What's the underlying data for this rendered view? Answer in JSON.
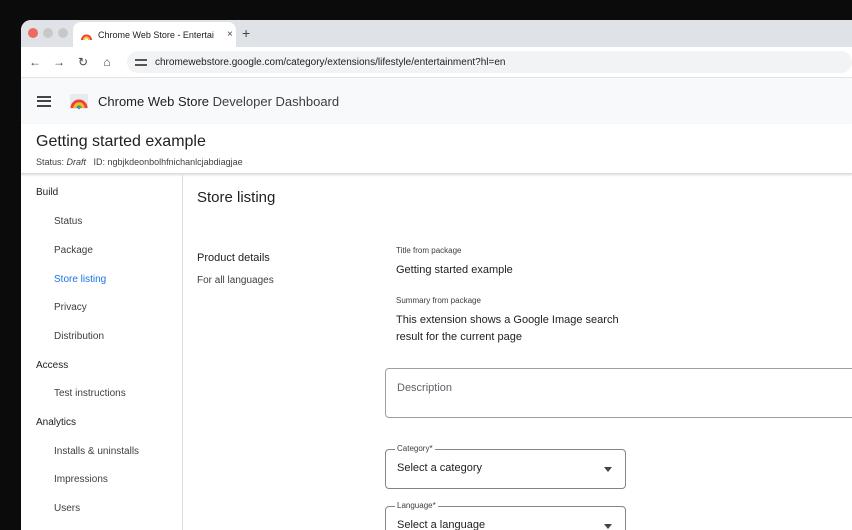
{
  "browser": {
    "tab_title": "Chrome Web Store - Entertai",
    "tab_close": "×",
    "new_tab": "+",
    "url": "chromewebstore.google.com/category/extensions/lifestyle/entertainment?hl=en",
    "nav": {
      "back": "←",
      "forward": "→",
      "reload": "↻",
      "home": "⌂"
    }
  },
  "header": {
    "app_name": "Chrome Web Store",
    "app_suffix": " Developer Dashboard"
  },
  "item": {
    "title": "Getting started example",
    "status_label": "Status: ",
    "status_value": "Draft",
    "id_text": "ID: ngbjkdeonbolhfnichanlcjabdiagjae"
  },
  "sidebar": {
    "sections": [
      {
        "title": "Build",
        "items": [
          "Status",
          "Package",
          "Store listing",
          "Privacy",
          "Distribution"
        ]
      },
      {
        "title": "Access",
        "items": [
          "Test instructions"
        ]
      },
      {
        "title": "Analytics",
        "items": [
          "Installs & uninstalls",
          "Impressions",
          "Users"
        ]
      }
    ],
    "active_item": "Store listing"
  },
  "main": {
    "title": "Store listing",
    "product_details": {
      "heading": "Product details",
      "subheading": "For all languages"
    },
    "fields": {
      "title_label": "Title from package",
      "title_value": "Getting started example",
      "summary_label": "Summary from package",
      "summary_value": "This extension shows a Google Image search result for the current page",
      "description_placeholder": "Description",
      "category_label": "Category*",
      "category_value": "Select a category",
      "language_label": "Language*",
      "language_value": "Select a language"
    }
  },
  "colors": {
    "accent": "#1a73e8",
    "header_bg": "#f8f9fa"
  }
}
